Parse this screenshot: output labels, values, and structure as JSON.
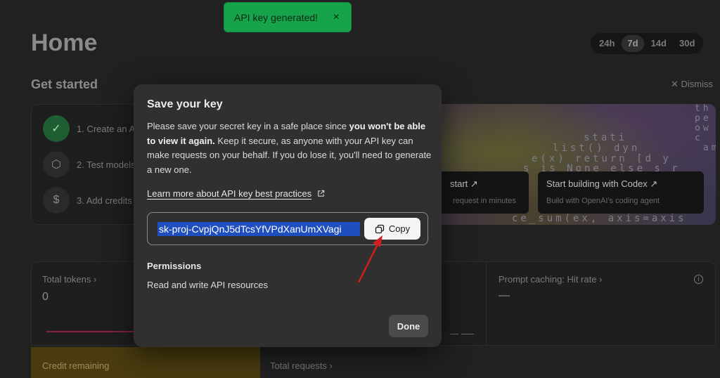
{
  "page": {
    "title": "Home",
    "ranges": [
      "24h",
      "7d",
      "14d",
      "30d"
    ],
    "active_range": "7d",
    "get_started": "Get started",
    "dismiss": "Dismiss",
    "steps": [
      {
        "label": "1. Create an A",
        "icon": "check-icon"
      },
      {
        "label": "2. Test models",
        "icon": "cube-icon"
      },
      {
        "label": "3. Add credits",
        "icon": "dollar-icon"
      }
    ],
    "hero_cards": [
      {
        "title": "start ↗",
        "subtitle": "request in minutes"
      },
      {
        "title": "Start building with Codex ↗",
        "subtitle": "Build with OpenAI's coding agent"
      }
    ],
    "hero_code": {
      "right_col": "th\npe\now\nc\n am",
      "line1": "stati",
      "line2": "list() dyn",
      "line3": "e(x) return [d y",
      "line4": "s is None else s r",
      "line5": "ce_sum(ex, axis=axis"
    },
    "metrics": {
      "total_tokens": "Total tokens",
      "total_tokens_value": "0",
      "prompt_caching": "Prompt caching: Hit rate",
      "prompt_caching_value": "—",
      "credit_remaining": "Credit remaining",
      "total_requests": "Total requests"
    }
  },
  "toast": {
    "message": "API key generated!",
    "close": "×"
  },
  "modal": {
    "title": "Save your key",
    "desc_part1": "Please save your secret key in a safe place since ",
    "desc_bold": "you won't be able to view it again.",
    "desc_part2": " Keep it secure, as anyone with your API key can make requests on your behalf. If you do lose it, you'll need to generate a new one.",
    "learn_more": "Learn more about API key best practices",
    "api_key": "sk-proj-CvpjQnJ5dTcsYfVPdXanUmXVagi",
    "copy_label": "Copy",
    "permissions_title": "Permissions",
    "permissions_value": "Read and write API resources",
    "done_label": "Done"
  },
  "colors": {
    "toast_bg": "#17a34a",
    "modal_bg": "#303030",
    "selection": "#1f4fbf",
    "annotation_arrow": "#d01f1f"
  }
}
